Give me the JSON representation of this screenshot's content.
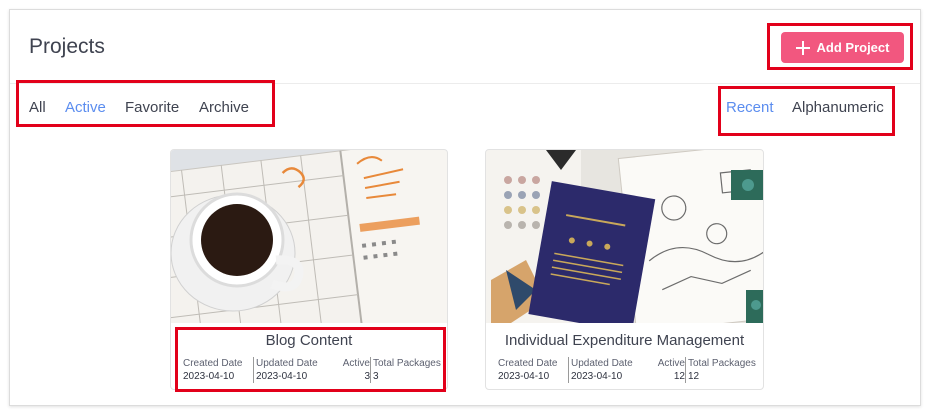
{
  "header": {
    "title": "Projects",
    "add_button_label": "Add Project"
  },
  "filters": {
    "tabs": [
      "All",
      "Active",
      "Favorite",
      "Archive"
    ],
    "selected": "Active"
  },
  "sort": {
    "options": [
      "Recent",
      "Alphanumeric"
    ],
    "selected": "Recent"
  },
  "projects": [
    {
      "name": "Blog Content",
      "created_label": "Created Date",
      "created": "2023-04-10",
      "updated_label": "Updated Date",
      "updated": "2023-04-10",
      "active_label": "Active",
      "active": "3",
      "packages_label": "Total Packages",
      "packages": "3"
    },
    {
      "name": "Individual Expenditure Management",
      "created_label": "Created Date",
      "created": "2023-04-10",
      "updated_label": "Updated Date",
      "updated": "2023-04-10",
      "active_label": "Active",
      "active": "12",
      "packages_label": "Total Packages",
      "packages": "12"
    }
  ],
  "colors": {
    "accent": "#f2577f",
    "active_tab": "#5b8def",
    "highlight": "#e2001a"
  }
}
